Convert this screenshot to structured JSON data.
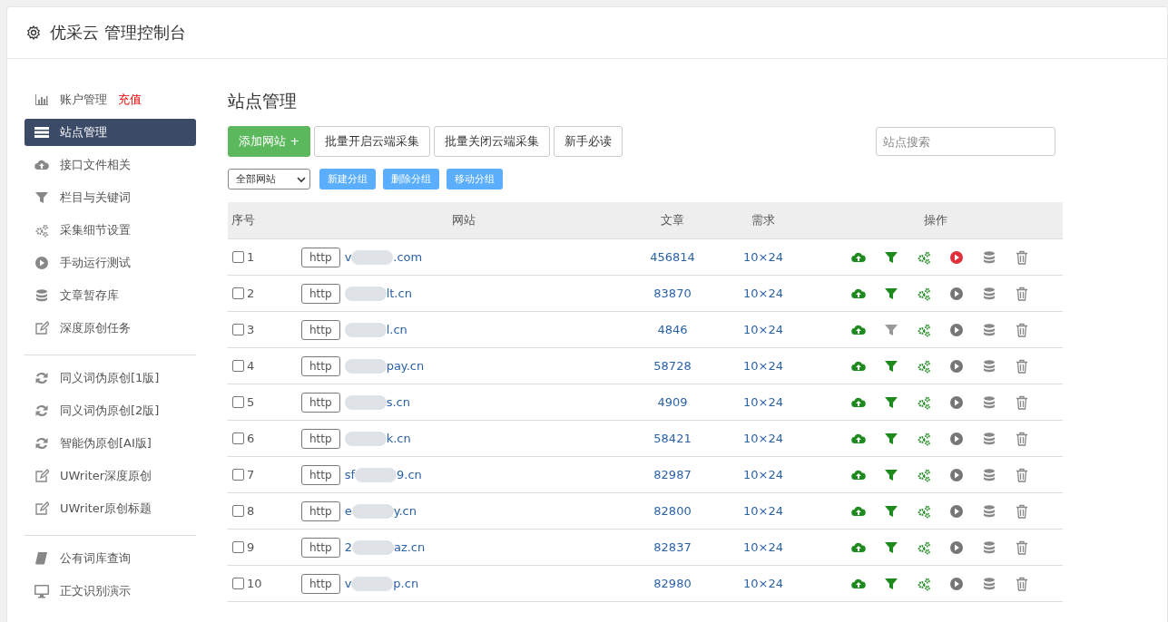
{
  "header": {
    "title": "优采云 管理控制台"
  },
  "sidebar": {
    "groups": [
      {
        "items": [
          {
            "kind": "chart",
            "label": "账户管理",
            "badge": "充值",
            "selected": false
          },
          {
            "kind": "server",
            "label": "站点管理",
            "selected": true
          },
          {
            "kind": "cloud",
            "label": "接口文件相关",
            "selected": false
          },
          {
            "kind": "filter",
            "label": "栏目与关键词",
            "selected": false
          },
          {
            "kind": "gears",
            "label": "采集细节设置",
            "selected": false
          },
          {
            "kind": "play",
            "label": "手动运行测试",
            "selected": false
          },
          {
            "kind": "database",
            "label": "文章暂存库",
            "selected": false
          },
          {
            "kind": "edit",
            "label": "深度原创任务",
            "selected": false
          }
        ]
      },
      {
        "items": [
          {
            "kind": "refresh",
            "label": "同义词伪原创[1版]",
            "selected": false
          },
          {
            "kind": "refresh",
            "label": "同义词伪原创[2版]",
            "selected": false
          },
          {
            "kind": "refresh",
            "label": "智能伪原创[AI版]",
            "selected": false
          },
          {
            "kind": "edit",
            "label": "UWriter深度原创",
            "selected": false
          },
          {
            "kind": "edit",
            "label": "UWriter原创标题",
            "selected": false
          }
        ]
      },
      {
        "items": [
          {
            "kind": "book",
            "label": "公有词库查询",
            "selected": false
          },
          {
            "kind": "monitor",
            "label": "正文识别演示",
            "selected": false
          }
        ]
      }
    ]
  },
  "main": {
    "title": "站点管理",
    "buttons": [
      {
        "label": "添加网站 +",
        "kind": "primary"
      },
      {
        "label": "批量开启云端采集",
        "kind": "default"
      },
      {
        "label": "批量关闭云端采集",
        "kind": "default"
      },
      {
        "label": "新手必读",
        "kind": "default"
      }
    ],
    "search": {
      "placeholder": "站点搜索"
    },
    "group_select": {
      "value": "全部网站"
    },
    "group_buttons": [
      "新建分组",
      "删除分组",
      "移动分组"
    ],
    "table": {
      "columns": [
        "序号",
        "网站",
        "文章",
        "需求",
        "操作"
      ],
      "rows": [
        {
          "checked": false,
          "index": "1",
          "protocol": "http",
          "domain_start": "v",
          "domain_end": ".com",
          "articles": "456814",
          "demand": "10×24",
          "filter_on": true,
          "running": true
        },
        {
          "checked": false,
          "index": "2",
          "protocol": "http",
          "domain_end": "lt.cn",
          "articles": "83870",
          "demand": "10×24",
          "filter_on": true,
          "running": false
        },
        {
          "checked": false,
          "index": "3",
          "protocol": "http",
          "domain_end": "l.cn",
          "articles": "4846",
          "demand": "10×24",
          "filter_on": false,
          "running": false
        },
        {
          "checked": false,
          "index": "4",
          "protocol": "http",
          "domain_end": "pay.cn",
          "articles": "58728",
          "demand": "10×24",
          "filter_on": true,
          "running": false
        },
        {
          "checked": false,
          "index": "5",
          "protocol": "http",
          "domain_end": "s.cn",
          "articles": "4909",
          "demand": "10×24",
          "filter_on": true,
          "running": false
        },
        {
          "checked": false,
          "index": "6",
          "protocol": "http",
          "domain_end": "k.cn",
          "articles": "58421",
          "demand": "10×24",
          "filter_on": true,
          "running": false
        },
        {
          "checked": false,
          "index": "7",
          "protocol": "http",
          "domain_start": "sf",
          "domain_end": "9.cn",
          "articles": "82987",
          "demand": "10×24",
          "filter_on": true,
          "running": false
        },
        {
          "checked": false,
          "index": "8",
          "protocol": "http",
          "domain_start": "e",
          "domain_end": "y.cn",
          "articles": "82800",
          "demand": "10×24",
          "filter_on": true,
          "running": false
        },
        {
          "checked": false,
          "index": "9",
          "protocol": "http",
          "domain_start": "2",
          "domain_end": "az.cn",
          "articles": "82837",
          "demand": "10×24",
          "filter_on": true,
          "running": false
        },
        {
          "checked": false,
          "index": "10",
          "protocol": "http",
          "domain_start": "v",
          "domain_end": "p.cn",
          "articles": "82980",
          "demand": "10×24",
          "filter_on": true,
          "running": false
        }
      ]
    }
  }
}
